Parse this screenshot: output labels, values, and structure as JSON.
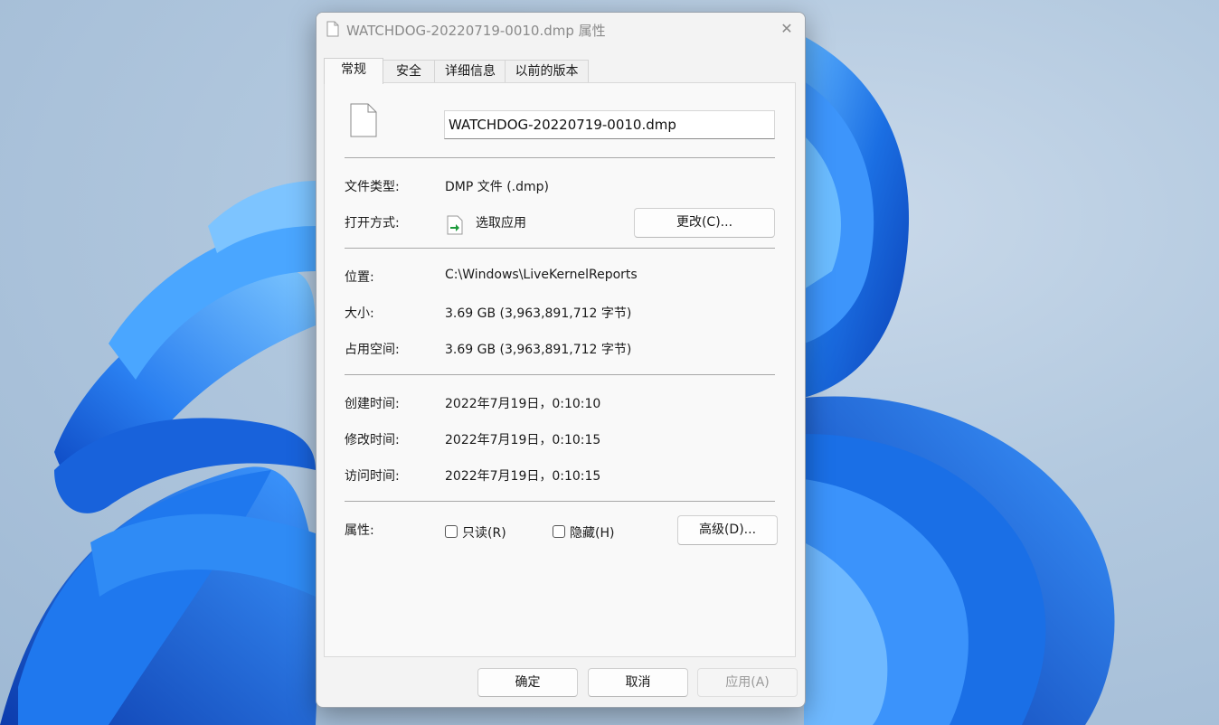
{
  "window": {
    "title": "WATCHDOG-20220719-0010.dmp 属性",
    "close_glyph": "✕"
  },
  "tabs": [
    {
      "label": "常规",
      "active": true
    },
    {
      "label": "安全",
      "active": false
    },
    {
      "label": "详细信息",
      "active": false
    },
    {
      "label": "以前的版本",
      "active": false
    }
  ],
  "general": {
    "filename": "WATCHDOG-20220719-0010.dmp",
    "file_type_label": "文件类型:",
    "file_type_value": "DMP 文件 (.dmp)",
    "open_with_label": "打开方式:",
    "open_with_value": "选取应用",
    "change_button": "更改(C)...",
    "location_label": "位置:",
    "location_value": "C:\\Windows\\LiveKernelReports",
    "size_label": "大小:",
    "size_value": "3.69 GB (3,963,891,712 字节)",
    "size_on_disk_label": "占用空间:",
    "size_on_disk_value": "3.69 GB (3,963,891,712 字节)",
    "created_label": "创建时间:",
    "created_value": "2022年7月19日，0:10:10",
    "modified_label": "修改时间:",
    "modified_value": "2022年7月19日，0:10:15",
    "accessed_label": "访问时间:",
    "accessed_value": "2022年7月19日，0:10:15",
    "attributes_label": "属性:",
    "readonly_label": "只读(R)",
    "readonly_checked": false,
    "hidden_label": "隐藏(H)",
    "hidden_checked": false,
    "advanced_button": "高级(D)..."
  },
  "footer": {
    "ok_button": "确定",
    "cancel_button": "取消",
    "apply_button": "应用(A)",
    "apply_enabled": false
  },
  "colors": {
    "wallpaper_bloom": "#1a6fe0",
    "dialog_bg": "#f3f3f3",
    "panel_bg": "#f9f9f9"
  },
  "icons": {
    "title": "document-icon",
    "file": "document-icon",
    "open_with": "open-with-app-icon",
    "close": "close-icon"
  }
}
